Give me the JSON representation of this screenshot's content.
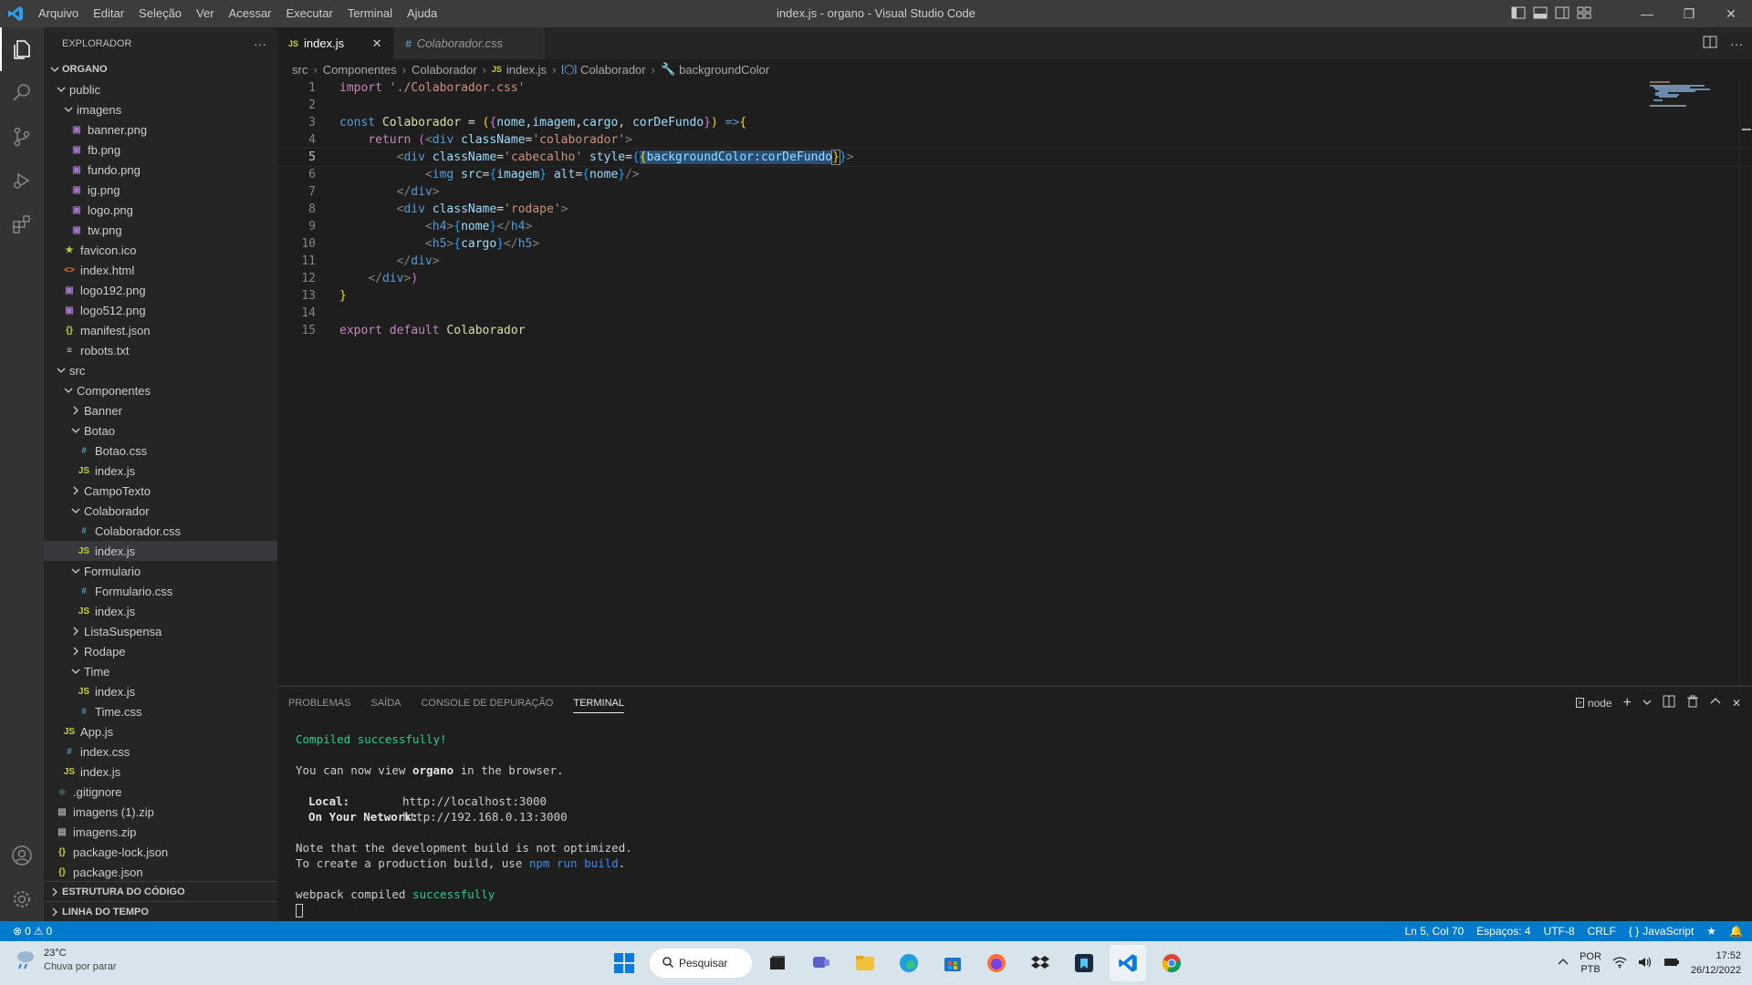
{
  "window": {
    "title": "index.js - organo - Visual Studio Code",
    "menu": [
      "Arquivo",
      "Editar",
      "Seleção",
      "Ver",
      "Acessar",
      "Executar",
      "Terminal",
      "Ajuda"
    ]
  },
  "sidebar": {
    "title": "EXPLORADOR",
    "root": "ORGANO",
    "tree": [
      {
        "label": "public",
        "depth": 0,
        "type": "folder",
        "open": true
      },
      {
        "label": "imagens",
        "depth": 1,
        "type": "folder",
        "open": true
      },
      {
        "label": "banner.png",
        "depth": 2,
        "type": "png"
      },
      {
        "label": "fb.png",
        "depth": 2,
        "type": "png"
      },
      {
        "label": "fundo.png",
        "depth": 2,
        "type": "png"
      },
      {
        "label": "ig.png",
        "depth": 2,
        "type": "png"
      },
      {
        "label": "logo.png",
        "depth": 2,
        "type": "png"
      },
      {
        "label": "tw.png",
        "depth": 2,
        "type": "png"
      },
      {
        "label": "favicon.ico",
        "depth": 1,
        "type": "ico"
      },
      {
        "label": "index.html",
        "depth": 1,
        "type": "html"
      },
      {
        "label": "logo192.png",
        "depth": 1,
        "type": "png"
      },
      {
        "label": "logo512.png",
        "depth": 1,
        "type": "png"
      },
      {
        "label": "manifest.json",
        "depth": 1,
        "type": "json"
      },
      {
        "label": "robots.txt",
        "depth": 1,
        "type": "txt"
      },
      {
        "label": "src",
        "depth": 0,
        "type": "folder",
        "open": true
      },
      {
        "label": "Componentes",
        "depth": 1,
        "type": "folder",
        "open": true
      },
      {
        "label": "Banner",
        "depth": 2,
        "type": "folder",
        "open": false
      },
      {
        "label": "Botao",
        "depth": 2,
        "type": "folder",
        "open": true
      },
      {
        "label": "Botao.css",
        "depth": 3,
        "type": "css"
      },
      {
        "label": "index.js",
        "depth": 3,
        "type": "js"
      },
      {
        "label": "CampoTexto",
        "depth": 2,
        "type": "folder",
        "open": false
      },
      {
        "label": "Colaborador",
        "depth": 2,
        "type": "folder",
        "open": true
      },
      {
        "label": "Colaborador.css",
        "depth": 3,
        "type": "css"
      },
      {
        "label": "index.js",
        "depth": 3,
        "type": "js",
        "selected": true
      },
      {
        "label": "Formulario",
        "depth": 2,
        "type": "folder",
        "open": true
      },
      {
        "label": "Formulario.css",
        "depth": 3,
        "type": "css"
      },
      {
        "label": "index.js",
        "depth": 3,
        "type": "js"
      },
      {
        "label": "ListaSuspensa",
        "depth": 2,
        "type": "folder",
        "open": false
      },
      {
        "label": "Rodape",
        "depth": 2,
        "type": "folder",
        "open": false
      },
      {
        "label": "Time",
        "depth": 2,
        "type": "folder",
        "open": true
      },
      {
        "label": "index.js",
        "depth": 3,
        "type": "js"
      },
      {
        "label": "Time.css",
        "depth": 3,
        "type": "css"
      },
      {
        "label": "App.js",
        "depth": 1,
        "type": "js"
      },
      {
        "label": "index.css",
        "depth": 1,
        "type": "css"
      },
      {
        "label": "index.js",
        "depth": 1,
        "type": "js"
      },
      {
        "label": ".gitignore",
        "depth": 0,
        "type": "git"
      },
      {
        "label": "imagens (1).zip",
        "depth": 0,
        "type": "zip"
      },
      {
        "label": "imagens.zip",
        "depth": 0,
        "type": "zip"
      },
      {
        "label": "package-lock.json",
        "depth": 0,
        "type": "json"
      },
      {
        "label": "package.json",
        "depth": 0,
        "type": "json"
      }
    ],
    "outline": "ESTRUTURA DO CÓDIGO",
    "timeline": "LINHA DO TEMPO"
  },
  "tabs": [
    {
      "label": "index.js",
      "icon": "JS",
      "active": true
    },
    {
      "label": "Colaborador.css",
      "icon": "#",
      "active": false
    }
  ],
  "breadcrumb": [
    "src",
    "Componentes",
    "Colaborador",
    "index.js",
    "Colaborador",
    "backgroundColor"
  ],
  "code": {
    "line_numbers": [
      "1",
      "2",
      "3",
      "4",
      "5",
      "6",
      "7",
      "8",
      "9",
      "10",
      "11",
      "12",
      "13",
      "14",
      "15"
    ],
    "current_line": 5
  },
  "panel": {
    "tabs": [
      "PROBLEMAS",
      "SAÍDA",
      "CONSOLE DE DEPURAÇÃO",
      "TERMINAL"
    ],
    "active_tab": "TERMINAL",
    "shell": "node",
    "terminal": {
      "compiled": "Compiled successfully!",
      "view_pre": "You can now view ",
      "app": "organo",
      "view_post": " in the browser.",
      "local_label": "Local:",
      "local_url": "http://localhost:3000",
      "network_label": "On Your Network:",
      "network_url": "http://192.168.0.13:3000",
      "note": "Note that the development build is not optimized.",
      "prod_pre": "To create a production build, use ",
      "prod_cmd": "npm run build",
      "prod_post": ".",
      "webpack_pre": "webpack compiled ",
      "webpack_ok": "successfully"
    }
  },
  "statusbar": {
    "errors": "0",
    "warnings": "0",
    "position": "Ln 5, Col 70",
    "spaces": "Espaços: 4",
    "encoding": "UTF-8",
    "eol": "CRLF",
    "language": "JavaScript"
  },
  "taskbar": {
    "temperature": "23°C",
    "weather": "Chuva por parar",
    "search": "Pesquisar",
    "lang": "POR",
    "layout": "PTB",
    "time": "17:52",
    "date": "26/12/2022"
  },
  "colors": {
    "accent": "#007acc",
    "js_icon": "#cbcb41",
    "css_icon": "#519aba",
    "png_icon": "#a074c4",
    "json_icon": "#cbcb41"
  }
}
